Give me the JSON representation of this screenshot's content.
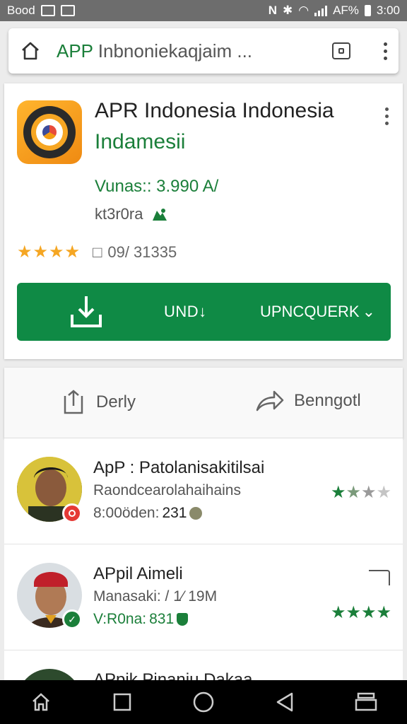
{
  "status_bar": {
    "carrier": "Bood",
    "battery_text": "AF%",
    "time": "3:00"
  },
  "browser": {
    "url_prefix": "APP",
    "url_rest": " Inbnoniekaqjaim ...",
    "icons": [
      "home-icon",
      "tab-switcher-icon",
      "overflow-menu-icon"
    ]
  },
  "app": {
    "title": "APR Indonesia Indonesia",
    "subtitle": "Indamesii",
    "version": "Vunas:: 3.990 A/",
    "developer": "kt3r0ra",
    "rating_count": "09/  31335",
    "rating_stars": 3.5,
    "install_label": "UND↓",
    "install_secondary": "UPNCQUERK",
    "accent_color": "#0f8a45"
  },
  "actions": [
    {
      "label": "Derly",
      "icon": "share-icon"
    },
    {
      "label": "Benngotl",
      "icon": "forward-icon"
    }
  ],
  "list": [
    {
      "title": "ApP : Patolanisakitilsai",
      "line2": "Raondcearolahaihains",
      "line3": "8:00öden:",
      "line3_value": "231",
      "stars": 2,
      "badge_color": "#e53935"
    },
    {
      "title": "APpil Aimeli",
      "line2": "Manasaki: ⁩/ 1∕ 19M",
      "line3": "V:R0na:",
      "line3_value": "831",
      "stars": 4,
      "badge_color": "#1b7f3a"
    },
    {
      "title": "APpik Pinaniu Dakaa"
    }
  ],
  "navbar": [
    "home-nav-icon",
    "recents-square-icon",
    "circle-home-icon",
    "back-triangle-icon",
    "menu-stack-icon"
  ]
}
